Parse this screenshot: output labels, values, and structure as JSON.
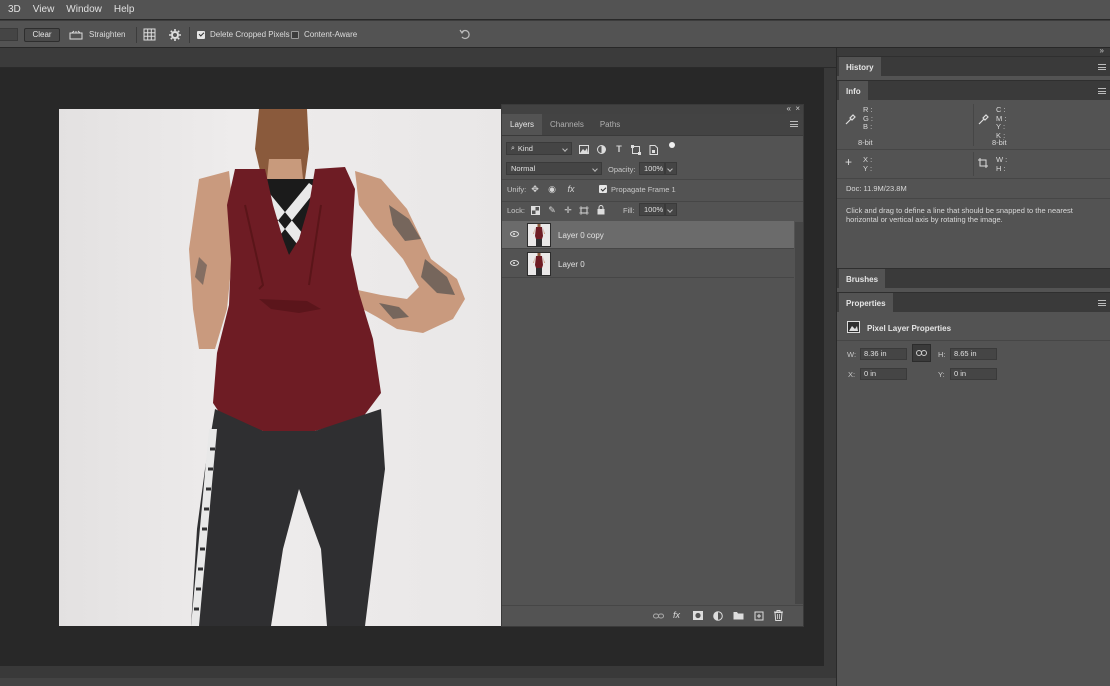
{
  "menubar": {
    "items": [
      "3D",
      "View",
      "Window",
      "Help"
    ]
  },
  "options": {
    "clear_label": "Clear",
    "straighten_label": "Straighten",
    "delete_cropped": {
      "label": "Delete Cropped Pixels",
      "checked": true
    },
    "content_aware": {
      "label": "Content-Aware",
      "checked": false
    }
  },
  "layers_panel": {
    "tabs": [
      "Layers",
      "Channels",
      "Paths"
    ],
    "filter_kind": "Kind",
    "blend_mode": "Normal",
    "opacity_label": "Opacity:",
    "opacity_value": "100%",
    "unify_label": "Unify:",
    "propagate_label": "Propagate Frame 1",
    "lock_label": "Lock:",
    "fill_label": "Fill:",
    "fill_value": "100%",
    "layers": [
      {
        "name": "Layer 0 copy",
        "selected": true
      },
      {
        "name": "Layer 0",
        "selected": false
      }
    ]
  },
  "history": {
    "title": "History"
  },
  "info": {
    "title": "Info",
    "rgb_labels": "R :\nG :\nB :",
    "cmyk_labels": "C :\nM :\nY :\nK :",
    "bit_left": "8-bit",
    "bit_right": "8-bit",
    "xy_labels": "X :\nY :",
    "wh_labels": "W :\nH :",
    "doc": "Doc: 11.9M/23.8M",
    "hint": "Click and drag to define a line that should be snapped to the nearest horizontal or vertical axis by rotating the image."
  },
  "brushes": {
    "title": "Brushes"
  },
  "properties": {
    "title": "Properties",
    "subtitle": "Pixel Layer Properties",
    "w_label": "W:",
    "w_value": "8.36 in",
    "h_label": "H:",
    "h_value": "8.65 in",
    "x_label": "X:",
    "x_value": "0 in",
    "y_label": "Y:",
    "y_value": "0 in"
  },
  "colors": {
    "panel": "#535353",
    "dark": "#282828",
    "shirt": "#6e1c24"
  }
}
